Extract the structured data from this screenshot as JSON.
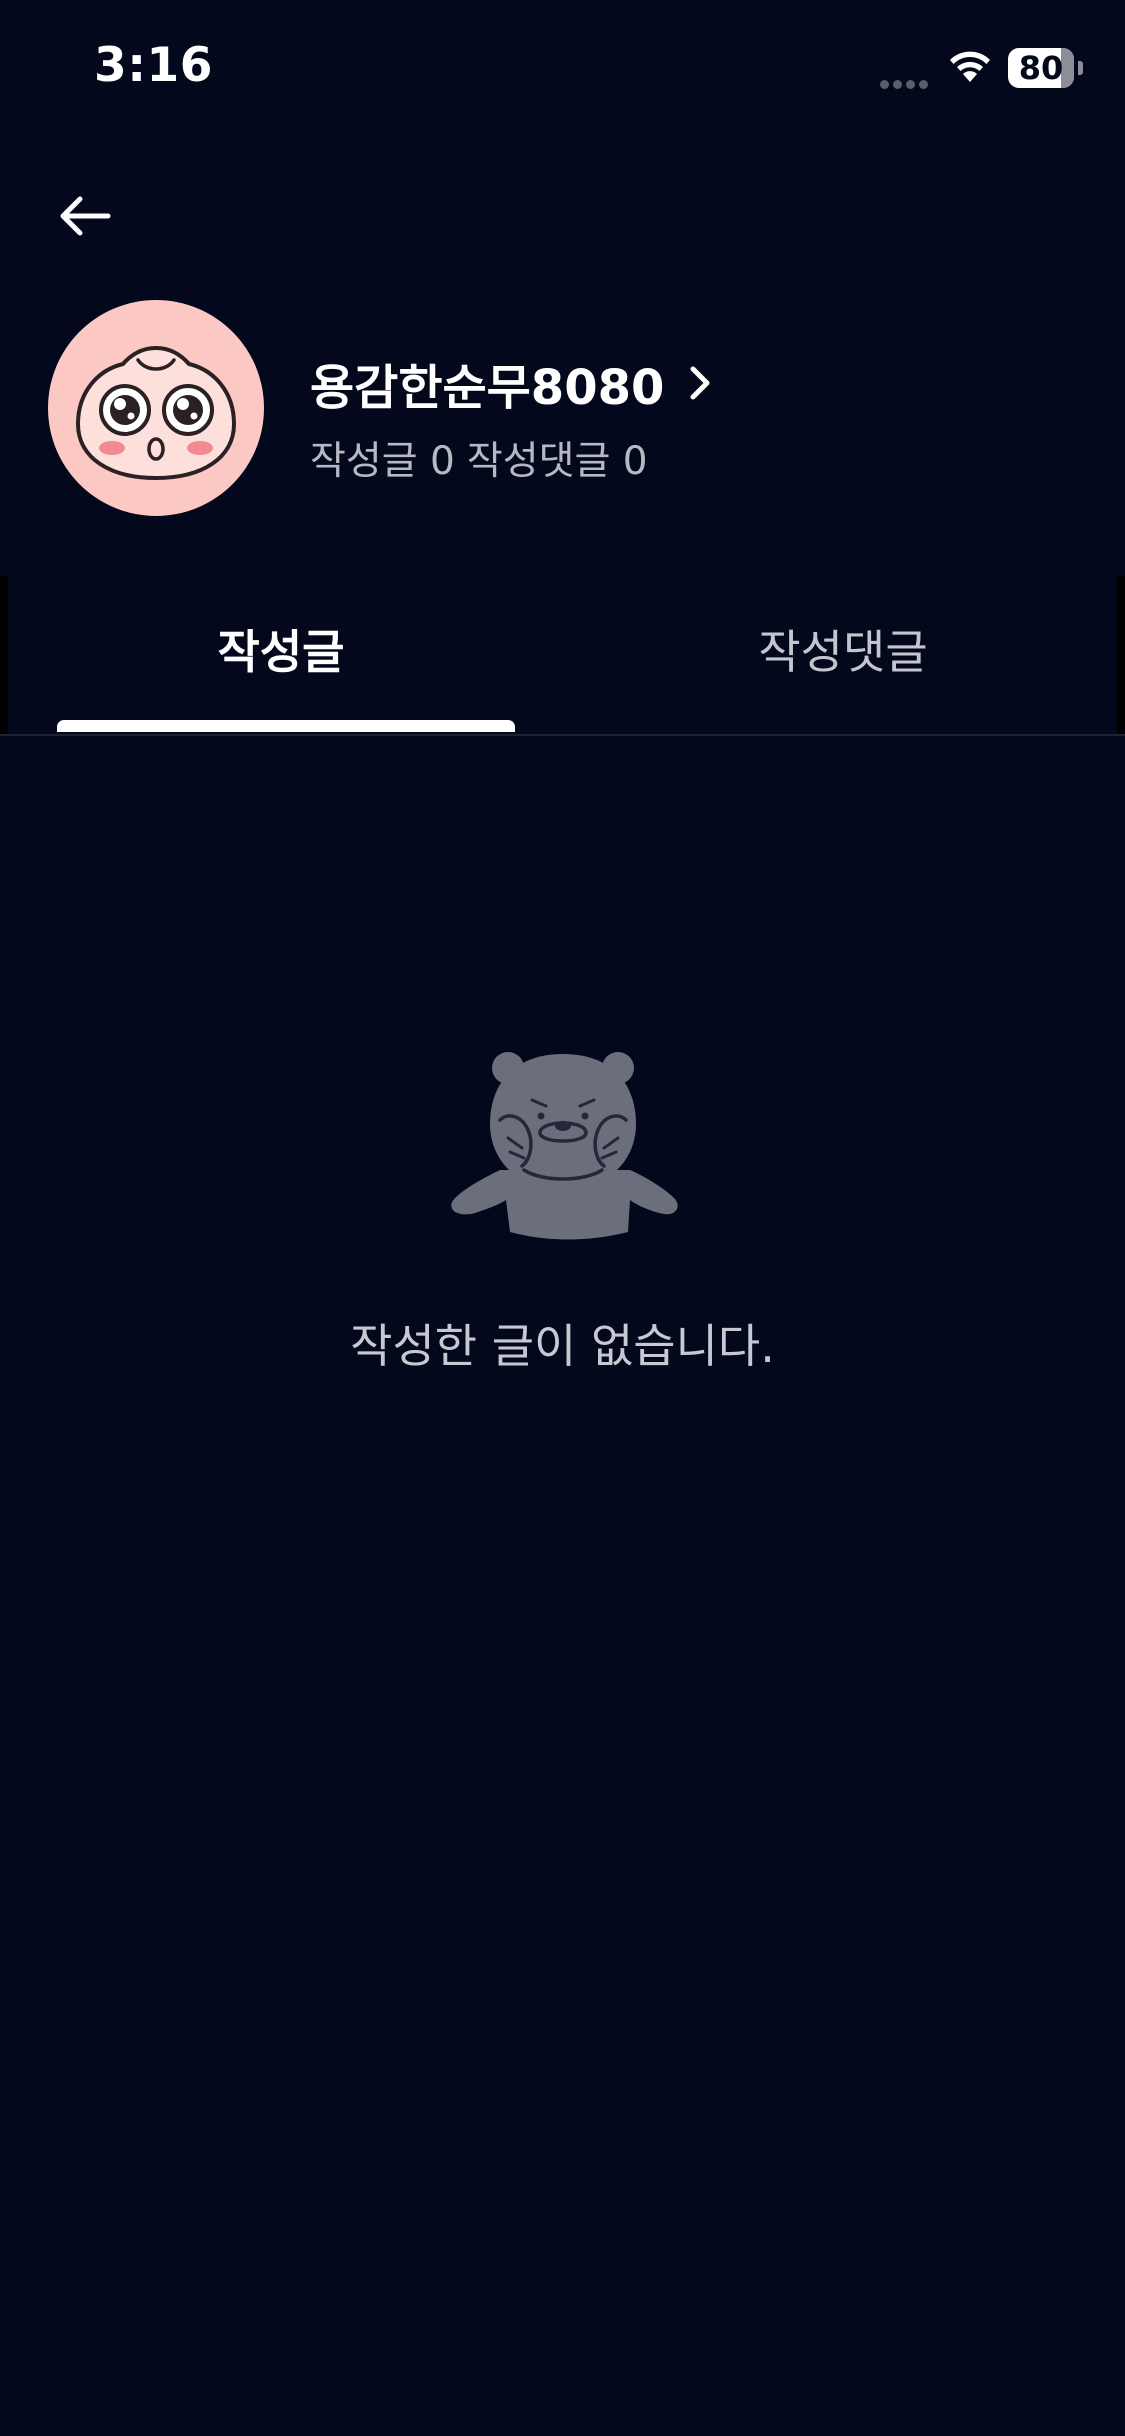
{
  "status_bar": {
    "time": "3:16",
    "battery_level": "80",
    "battery_fraction": 0.8
  },
  "header": {
    "back_icon": "arrow-left-icon"
  },
  "profile": {
    "nickname": "용감한순무8080",
    "chevron_icon": "chevron-right-icon",
    "posts_count_text": "작성글 0",
    "comments_count_text": "작성댓글 0",
    "avatar_icon": "apeach-character-avatar"
  },
  "tabs": [
    {
      "label": "작성글",
      "selected": true
    },
    {
      "label": "작성댓글",
      "selected": false
    }
  ],
  "empty_state": {
    "illustration_icon": "crying-bear-icon",
    "message": "작성한 글이 없습니다."
  },
  "colors": {
    "background": "#03081c",
    "avatar_bg": "#fbc8c3",
    "text_primary": "#ffffff",
    "text_secondary": "#b6b9c4",
    "illustration_gray": "#6b6f7b"
  }
}
